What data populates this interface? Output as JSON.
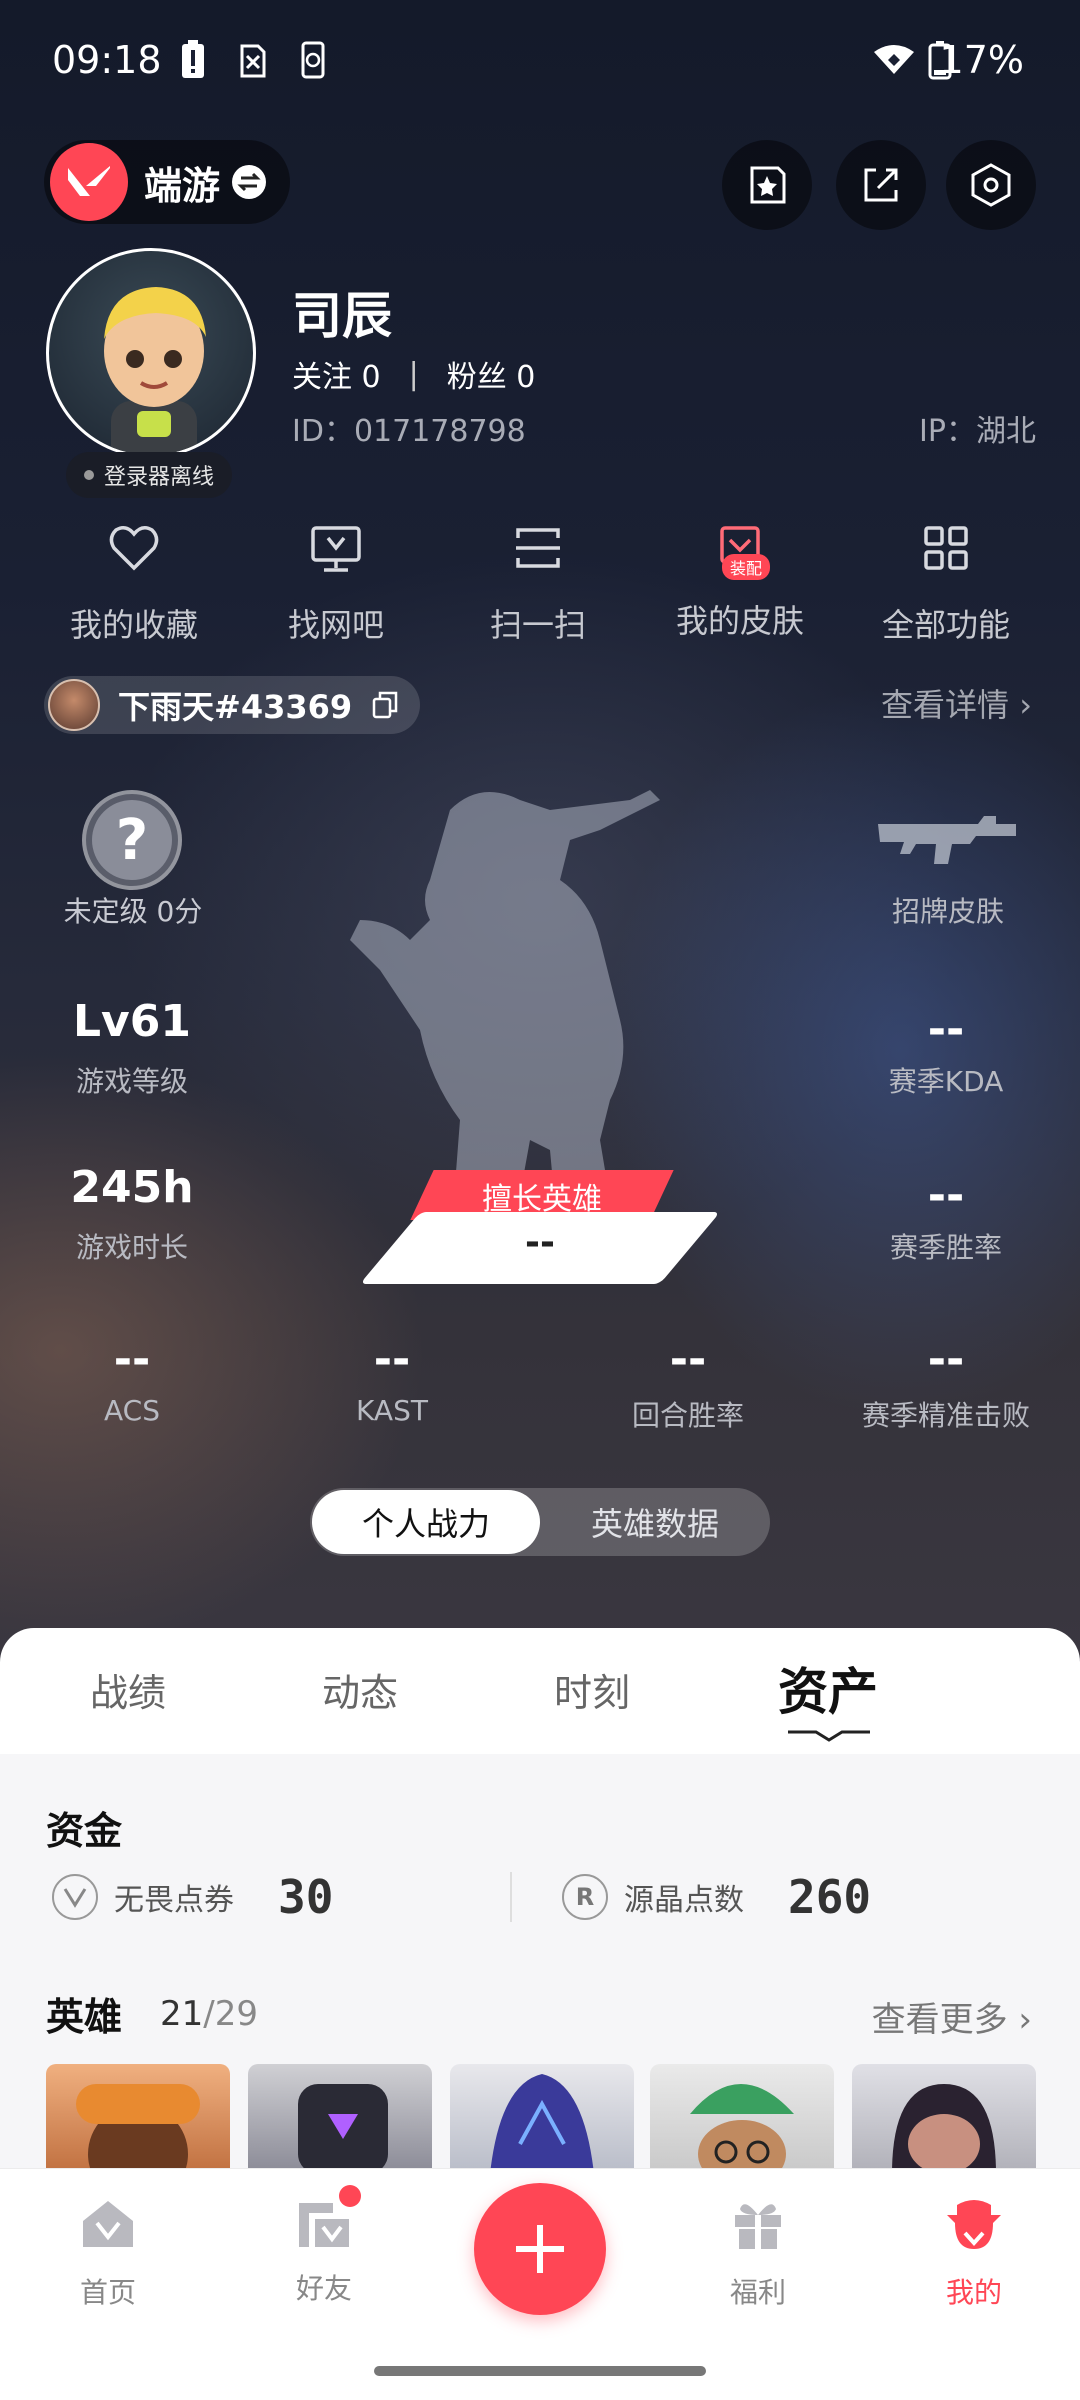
{
  "status_bar": {
    "time": "09:18",
    "battery": "17%"
  },
  "header": {
    "app_name": "端游"
  },
  "profile": {
    "username": "司辰",
    "follow_label": "关注",
    "follow_count": "0",
    "fans_label": "粉丝",
    "fans_count": "0",
    "id_text": "ID：017178798",
    "ip_text": "IP：湖北",
    "offline_text": "登录器离线"
  },
  "quick": {
    "favorites": "我的收藏",
    "netcafe": "找网吧",
    "scan": "扫一扫",
    "skins": "我的皮肤",
    "skins_tag": "装配",
    "all": "全部功能"
  },
  "game": {
    "riot_id": "下雨天#43369",
    "view_detail": "查看详情 ›",
    "rank_label": "未定级 0分",
    "rank_icon": "?",
    "signature_skin": "招牌皮肤",
    "level_value": "Lv61",
    "level_label": "游戏等级",
    "kda_value": "--",
    "kda_label": "赛季KDA",
    "hours_value": "245h",
    "hours_label": "游戏时长",
    "winrate_value": "--",
    "winrate_label": "赛季胜率",
    "best_agent_tag": "擅长英雄",
    "best_agent_value": "--",
    "acs_value": "--",
    "acs_label": "ACS",
    "kast_value": "--",
    "kast_label": "KAST",
    "round_value": "--",
    "round_label": "回合胜率",
    "kills_value": "--",
    "kills_label": "赛季精准击败"
  },
  "toggle": {
    "active": "个人战力",
    "inactive": "英雄数据"
  },
  "tabs": [
    "战绩",
    "动态",
    "时刻",
    "资产"
  ],
  "assets": {
    "funds_title": "资金",
    "vp_label": "无畏点券",
    "vp_value": "30",
    "rp_label": "源晶点数",
    "rp_value": "260",
    "rp_icon": "R",
    "heroes_title": "英雄",
    "heroes_owned": "21",
    "heroes_total": "/29",
    "see_more": "查看更多 ›"
  },
  "nav": {
    "home": "首页",
    "friends": "好友",
    "welfare": "福利",
    "mine": "我的"
  },
  "colors": {
    "accent": "#ff4655",
    "sheet_bg": "#f6f6f8"
  }
}
